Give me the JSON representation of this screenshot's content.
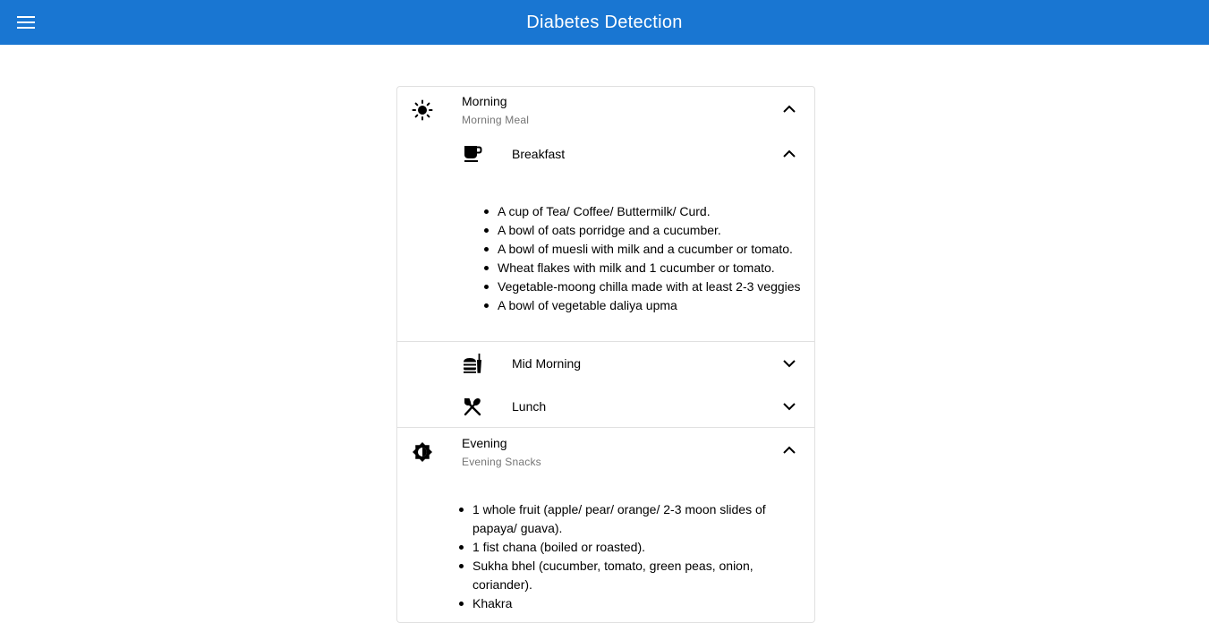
{
  "app": {
    "title": "Diabetes Detection"
  },
  "icons": {
    "menu": "menu-icon",
    "morning": "sun-icon",
    "breakfast": "coffee-cup-icon",
    "mid_morning": "fastfood-icon",
    "lunch": "utensils-icon",
    "evening": "brightness-icon",
    "expand_less": "chevron-up-icon",
    "expand_more": "chevron-down-icon"
  },
  "colors": {
    "appbar": "#1976d2",
    "appbar_text": "#ffffff",
    "subtitle": "#757575",
    "divider": "#e0e0e0"
  },
  "sections": {
    "morning": {
      "title": "Morning",
      "subtitle": "Morning Meal",
      "expanded": true,
      "breakfast": {
        "title": "Breakfast",
        "expanded": true,
        "items": [
          "A cup of Tea/ Coffee/ Buttermilk/ Curd.",
          "A bowl of oats porridge and a cucumber.",
          "A bowl of muesli with milk and a cucumber or tomato.",
          "Wheat flakes with milk and 1 cucumber or tomato.",
          "Vegetable-moong chilla made with at least 2-3 veggies",
          "A bowl of vegetable daliya upma"
        ]
      },
      "mid_morning": {
        "title": "Mid Morning",
        "expanded": false
      },
      "lunch": {
        "title": "Lunch",
        "expanded": false
      }
    },
    "evening": {
      "title": "Evening",
      "subtitle": "Evening Snacks",
      "expanded": true,
      "items": [
        "1 whole fruit (apple/ pear/ orange/ 2-3 moon slides of papaya/ guava).",
        "1 fist chana (boiled or roasted).",
        "Sukha bhel (cucumber, tomato, green peas, onion, coriander).",
        "Khakra"
      ]
    }
  }
}
